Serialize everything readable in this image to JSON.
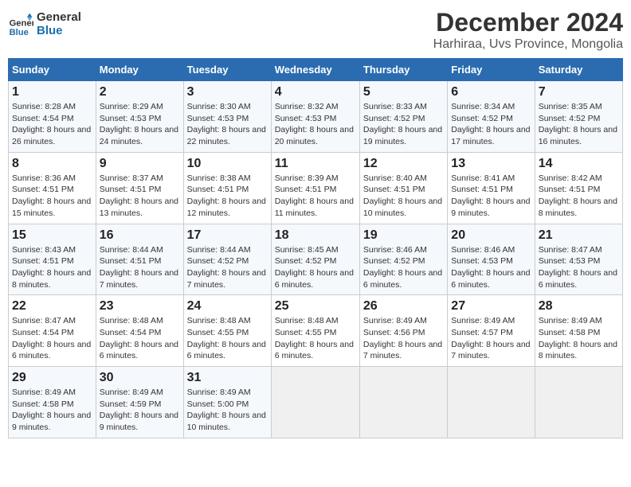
{
  "logo": {
    "line1": "General",
    "line2": "Blue"
  },
  "title": "December 2024",
  "subtitle": "Harhiraa, Uvs Province, Mongolia",
  "days_of_week": [
    "Sunday",
    "Monday",
    "Tuesday",
    "Wednesday",
    "Thursday",
    "Friday",
    "Saturday"
  ],
  "weeks": [
    [
      {
        "day": "1",
        "sunrise": "8:28 AM",
        "sunset": "4:54 PM",
        "daylight": "8 hours and 26 minutes."
      },
      {
        "day": "2",
        "sunrise": "8:29 AM",
        "sunset": "4:53 PM",
        "daylight": "8 hours and 24 minutes."
      },
      {
        "day": "3",
        "sunrise": "8:30 AM",
        "sunset": "4:53 PM",
        "daylight": "8 hours and 22 minutes."
      },
      {
        "day": "4",
        "sunrise": "8:32 AM",
        "sunset": "4:53 PM",
        "daylight": "8 hours and 20 minutes."
      },
      {
        "day": "5",
        "sunrise": "8:33 AM",
        "sunset": "4:52 PM",
        "daylight": "8 hours and 19 minutes."
      },
      {
        "day": "6",
        "sunrise": "8:34 AM",
        "sunset": "4:52 PM",
        "daylight": "8 hours and 17 minutes."
      },
      {
        "day": "7",
        "sunrise": "8:35 AM",
        "sunset": "4:52 PM",
        "daylight": "8 hours and 16 minutes."
      }
    ],
    [
      {
        "day": "8",
        "sunrise": "8:36 AM",
        "sunset": "4:51 PM",
        "daylight": "8 hours and 15 minutes."
      },
      {
        "day": "9",
        "sunrise": "8:37 AM",
        "sunset": "4:51 PM",
        "daylight": "8 hours and 13 minutes."
      },
      {
        "day": "10",
        "sunrise": "8:38 AM",
        "sunset": "4:51 PM",
        "daylight": "8 hours and 12 minutes."
      },
      {
        "day": "11",
        "sunrise": "8:39 AM",
        "sunset": "4:51 PM",
        "daylight": "8 hours and 11 minutes."
      },
      {
        "day": "12",
        "sunrise": "8:40 AM",
        "sunset": "4:51 PM",
        "daylight": "8 hours and 10 minutes."
      },
      {
        "day": "13",
        "sunrise": "8:41 AM",
        "sunset": "4:51 PM",
        "daylight": "8 hours and 9 minutes."
      },
      {
        "day": "14",
        "sunrise": "8:42 AM",
        "sunset": "4:51 PM",
        "daylight": "8 hours and 8 minutes."
      }
    ],
    [
      {
        "day": "15",
        "sunrise": "8:43 AM",
        "sunset": "4:51 PM",
        "daylight": "8 hours and 8 minutes."
      },
      {
        "day": "16",
        "sunrise": "8:44 AM",
        "sunset": "4:51 PM",
        "daylight": "8 hours and 7 minutes."
      },
      {
        "day": "17",
        "sunrise": "8:44 AM",
        "sunset": "4:52 PM",
        "daylight": "8 hours and 7 minutes."
      },
      {
        "day": "18",
        "sunrise": "8:45 AM",
        "sunset": "4:52 PM",
        "daylight": "8 hours and 6 minutes."
      },
      {
        "day": "19",
        "sunrise": "8:46 AM",
        "sunset": "4:52 PM",
        "daylight": "8 hours and 6 minutes."
      },
      {
        "day": "20",
        "sunrise": "8:46 AM",
        "sunset": "4:53 PM",
        "daylight": "8 hours and 6 minutes."
      },
      {
        "day": "21",
        "sunrise": "8:47 AM",
        "sunset": "4:53 PM",
        "daylight": "8 hours and 6 minutes."
      }
    ],
    [
      {
        "day": "22",
        "sunrise": "8:47 AM",
        "sunset": "4:54 PM",
        "daylight": "8 hours and 6 minutes."
      },
      {
        "day": "23",
        "sunrise": "8:48 AM",
        "sunset": "4:54 PM",
        "daylight": "8 hours and 6 minutes."
      },
      {
        "day": "24",
        "sunrise": "8:48 AM",
        "sunset": "4:55 PM",
        "daylight": "8 hours and 6 minutes."
      },
      {
        "day": "25",
        "sunrise": "8:48 AM",
        "sunset": "4:55 PM",
        "daylight": "8 hours and 6 minutes."
      },
      {
        "day": "26",
        "sunrise": "8:49 AM",
        "sunset": "4:56 PM",
        "daylight": "8 hours and 7 minutes."
      },
      {
        "day": "27",
        "sunrise": "8:49 AM",
        "sunset": "4:57 PM",
        "daylight": "8 hours and 7 minutes."
      },
      {
        "day": "28",
        "sunrise": "8:49 AM",
        "sunset": "4:58 PM",
        "daylight": "8 hours and 8 minutes."
      }
    ],
    [
      {
        "day": "29",
        "sunrise": "8:49 AM",
        "sunset": "4:58 PM",
        "daylight": "8 hours and 9 minutes."
      },
      {
        "day": "30",
        "sunrise": "8:49 AM",
        "sunset": "4:59 PM",
        "daylight": "8 hours and 9 minutes."
      },
      {
        "day": "31",
        "sunrise": "8:49 AM",
        "sunset": "5:00 PM",
        "daylight": "8 hours and 10 minutes."
      },
      null,
      null,
      null,
      null
    ]
  ],
  "labels": {
    "sunrise": "Sunrise:",
    "sunset": "Sunset:",
    "daylight": "Daylight:"
  }
}
